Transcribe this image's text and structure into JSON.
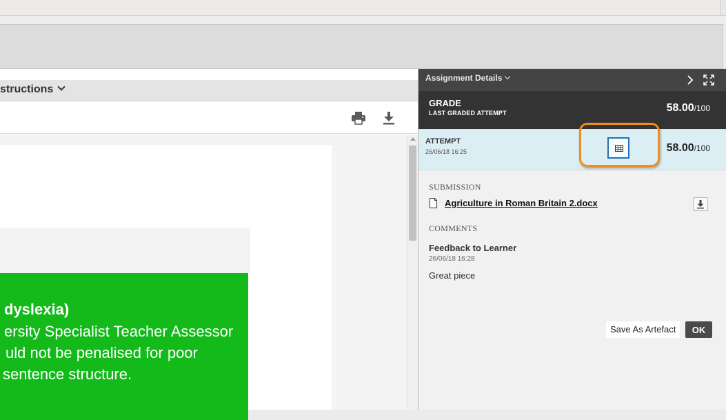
{
  "viewer": {
    "instructions_label": "structions",
    "print_icon": "printer-icon",
    "download_icon": "download-icon",
    "document": {
      "line1": "dyslexia)",
      "line2": "ersity Specialist Teacher Assessor",
      "line3": "uld not be penalised for poor",
      "line4": "sentence structure."
    }
  },
  "panel": {
    "title": "Assignment Details",
    "grade": {
      "label": "GRADE",
      "sublabel": "LAST GRADED ATTEMPT",
      "score": "58.00",
      "out_of": "/100"
    },
    "attempt": {
      "label": "ATTEMPT",
      "date": "26/06/18 16:25",
      "score": "58.00",
      "out_of": "/100"
    },
    "submission": {
      "label": "SUBMISSION",
      "file_name": "Agriculture in Roman Britain 2.docx"
    },
    "comments": {
      "label": "COMMENTS",
      "title": "Feedback to Learner",
      "date": "26/06/18 16:28",
      "text": "Great piece"
    },
    "actions": {
      "save_artefact": "Save As Artefact",
      "ok": "OK"
    }
  },
  "colors": {
    "panel_header": "#444444",
    "grade_row": "#333333",
    "attempt_row": "#dbeef4",
    "doc_green": "#13ba1a",
    "highlight": "#f28c1c",
    "rubric_border": "#1d71b8"
  }
}
